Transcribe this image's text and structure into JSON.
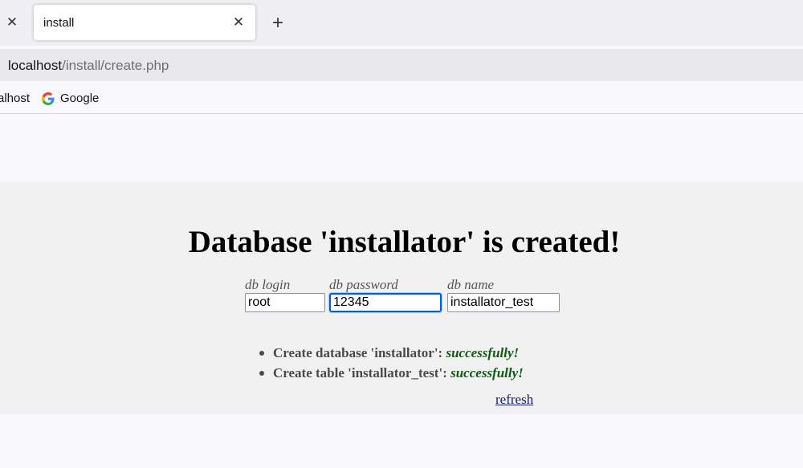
{
  "browser": {
    "tab": {
      "title": "install"
    },
    "url": {
      "host": "localhost",
      "path": "/install/create.php"
    },
    "bookmarks": [
      {
        "label": "alhost"
      },
      {
        "label": "Google",
        "icon": "google-icon"
      }
    ]
  },
  "page": {
    "heading": "Database 'installator' is created!",
    "fields": {
      "login": {
        "label": "db login",
        "value": "root"
      },
      "password": {
        "label": "db password",
        "value": "12345"
      },
      "name": {
        "label": "db name",
        "value": "installator_test"
      }
    },
    "results": [
      {
        "text": "Create database 'installator':",
        "status": "successfully!"
      },
      {
        "text": "Create table 'installator_test':",
        "status": "successfully!"
      }
    ],
    "refresh_label": "refresh",
    "colors": {
      "success": "#0c5a12",
      "focus": "#0060df",
      "link": "#1a1a6e"
    }
  }
}
